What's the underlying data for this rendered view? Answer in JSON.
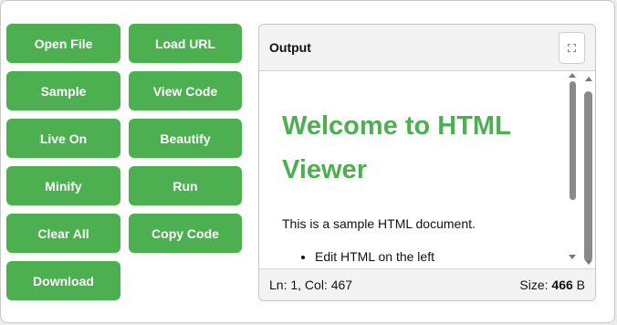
{
  "buttons": {
    "open_file": "Open File",
    "load_url": "Load URL",
    "sample": "Sample",
    "view_code": "View Code",
    "live_on": "Live On",
    "beautify": "Beautify",
    "minify": "Minify",
    "run": "Run",
    "clear_all": "Clear All",
    "copy_code": "Copy Code",
    "download": "Download"
  },
  "output": {
    "title": "Output",
    "expand_icon": "expand-icon",
    "document": {
      "heading": "Welcome to HTML Viewer",
      "paragraph": "This is a sample HTML document.",
      "list_items": [
        "Edit HTML on the left"
      ]
    },
    "status": {
      "cursor": "Ln: 1, Col: 467",
      "size_label": "Size:",
      "size_value": "466",
      "size_unit": "B"
    }
  },
  "colors": {
    "accent": "#4caf50",
    "heading": "#4caf50"
  }
}
